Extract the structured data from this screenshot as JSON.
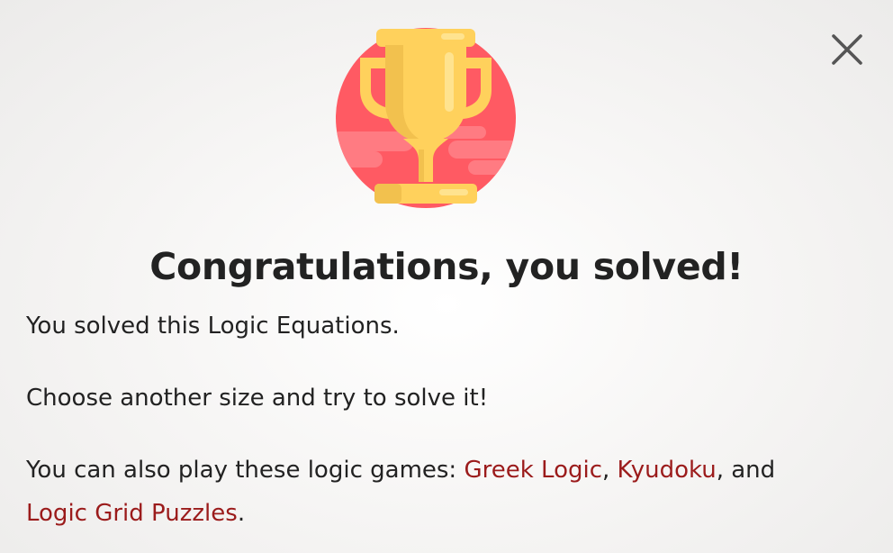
{
  "dialog": {
    "title": "Congratulations, you solved!",
    "message_solved": "You solved this Logic Equations.",
    "message_try": "Choose another size and try to solve it!",
    "also_play_prefix": "You can also play these logic games: ",
    "separator_comma": ", ",
    "separator_and": ", and ",
    "suffix_period": ".",
    "links": [
      {
        "label": "Greek Logic"
      },
      {
        "label": "Kyudoku"
      },
      {
        "label": "Logic Grid Puzzles"
      }
    ],
    "icons": {
      "trophy": "trophy-icon",
      "close": "close-icon"
    }
  },
  "colors": {
    "link": "#9b1b1b",
    "trophy_gold": "#ffd15c",
    "trophy_shade": "#f2c14e",
    "circle_red": "#ff5a63",
    "close_gray": "#555555"
  }
}
